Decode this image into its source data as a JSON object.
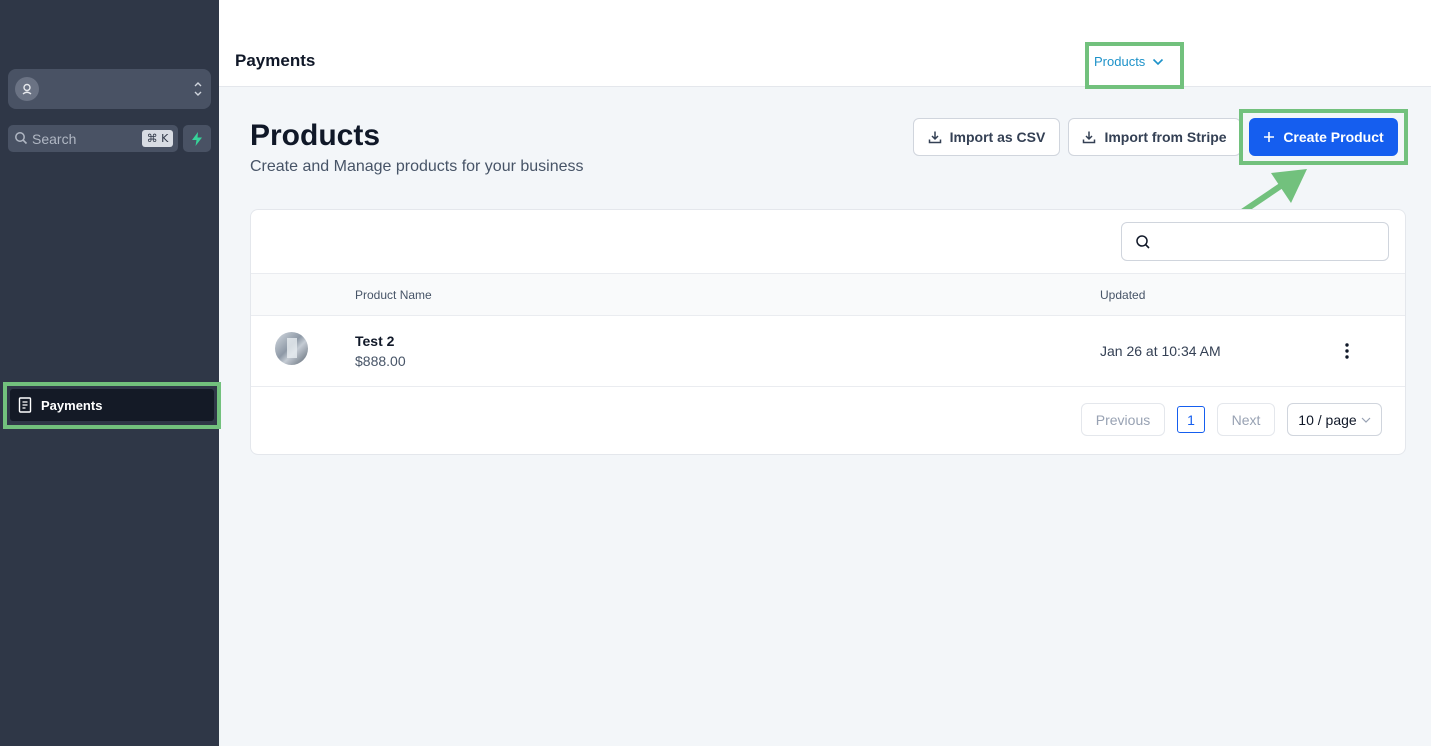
{
  "sidebar": {
    "search_label": "Search",
    "search_shortcut": "⌘ K",
    "nav_items": [
      {
        "label": "Payments",
        "icon": "receipt-icon",
        "active": true
      }
    ]
  },
  "header": {
    "title": "Payments",
    "tab_label": "Products",
    "tab_color": "#1d92c9"
  },
  "main": {
    "title": "Products",
    "subtitle": "Create and Manage products for your business",
    "buttons": {
      "import_csv": "Import as CSV",
      "import_stripe": "Import from Stripe",
      "create_product": "Create Product"
    },
    "search_placeholder": "",
    "table": {
      "columns": [
        "Product Name",
        "Updated"
      ],
      "rows": [
        {
          "name": "Test 2",
          "price": "$888.00",
          "updated": "Jan 26 at 10:34 AM"
        }
      ]
    },
    "pagination": {
      "previous": "Previous",
      "current_page": "1",
      "next": "Next",
      "page_size": "10 / page"
    }
  },
  "colors": {
    "sidebar_bg": "#2f3747",
    "primary": "#155eef",
    "highlight": "#72c17d"
  }
}
